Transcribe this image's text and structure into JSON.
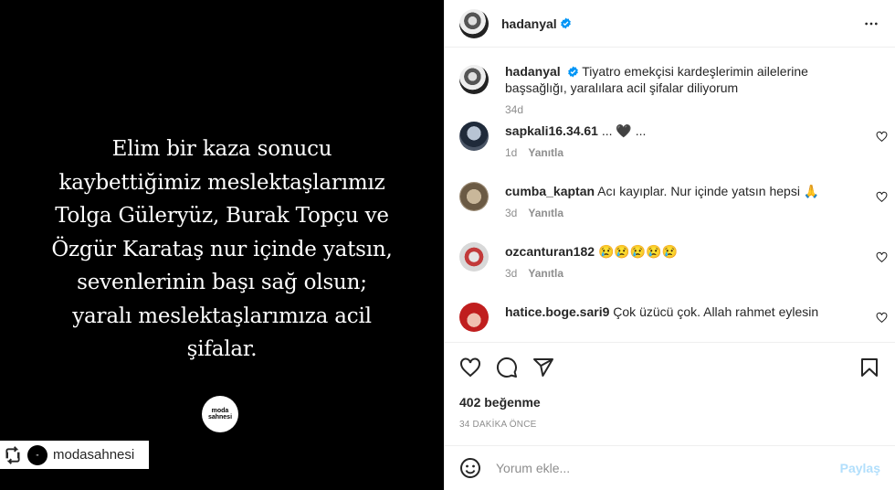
{
  "post_image": {
    "text": "Elim bir kaza sonucu\nkaybettiğimiz meslektaşlarımız\nTolga Güleryüz, Burak Topçu ve\nÖzgür Karataş nur içinde yatsın,\nsevenlerinin başı sağ olsun;\nyaralı meslektaşlarımıza acil\nşifalar.",
    "logo_text": "moda sahnesi",
    "repost_username": "modasahnesi",
    "background_color": "#000000"
  },
  "header": {
    "username": "hadanyal",
    "more_icon": "more-horizontal-icon"
  },
  "caption": {
    "username": "hadanyal",
    "text": "Tiyatro emekçisi kardeşlerimin ailelerine başsağlığı, yaralılara acil şifalar diliyorum",
    "time": "34d"
  },
  "comments": [
    {
      "username": "sapkali16.34.61",
      "text": "... 🖤 ...",
      "time": "1d",
      "reply_label": "Yanıtla"
    },
    {
      "username": "cumba_kaptan",
      "text": "Acı kayıplar. Nur içinde yatsın hepsi 🙏",
      "time": "3d",
      "reply_label": "Yanıtla"
    },
    {
      "username": "ozcanturan182",
      "text": "😢😢😢😢😢",
      "time": "3d",
      "reply_label": "Yanıtla"
    },
    {
      "username": "hatice.boge.sari9",
      "text": "Çok üzücü çok. Allah rahmet eylesin",
      "time": "",
      "reply_label": ""
    }
  ],
  "actions": {
    "likes": "402 beğenme",
    "timestamp": "34 DAKİKA ÖNCE"
  },
  "add_comment": {
    "placeholder": "Yorum ekle...",
    "post_label": "Paylaş"
  },
  "colors": {
    "verified": "#0095f6",
    "post_button_disabled": "#b2dffc",
    "secondary_text": "#8e8e8e"
  }
}
